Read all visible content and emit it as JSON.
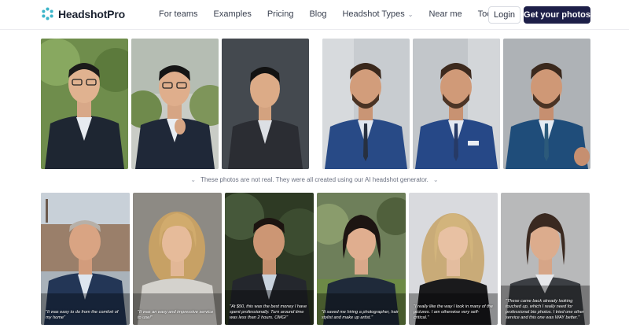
{
  "brand": {
    "name": "HeadshotPro"
  },
  "nav": {
    "items": [
      {
        "label": "For teams",
        "dropdown": false
      },
      {
        "label": "Examples",
        "dropdown": false
      },
      {
        "label": "Pricing",
        "dropdown": false
      },
      {
        "label": "Blog",
        "dropdown": false
      },
      {
        "label": "Headshot Types",
        "dropdown": true
      },
      {
        "label": "Near me",
        "dropdown": false
      },
      {
        "label": "Tools",
        "dropdown": true
      }
    ],
    "login_label": "Login",
    "cta_label": "Get your photos"
  },
  "gallery": {
    "disclaimer": "These photos are not real. They were all created using our AI headshot generator.",
    "testimonials": [
      "\"It was easy to do from the comfort of my home\"",
      "\"It was an easy and impressive service to use!\"",
      "\"At $50, this was the best money I have spent professionally. Turn around time was less than 2 hours. OMG!\"",
      "\"It saved me hiring a photographer, hair stylist and make up artist.\"",
      "\"I really like the way I look in many of the pictures. I am otherwise very self-critical.\"",
      "\"These came back already looking touched up, which I really need for professional bio photos. I tried one other service and this one was WAY better.\""
    ]
  },
  "colors": {
    "cta": "#1d1f48",
    "brand_icon": "#3bb5c9"
  }
}
